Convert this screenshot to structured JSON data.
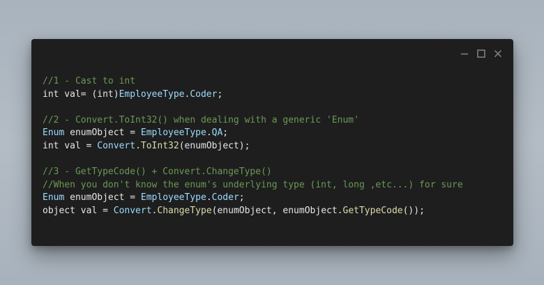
{
  "window": {
    "controls": [
      "minimize-icon",
      "maximize-icon",
      "close-icon"
    ]
  },
  "code": {
    "lines": [
      [
        {
          "t": "//1 - Cast to int",
          "k": "cm"
        }
      ],
      [
        {
          "t": "int val= (int)",
          "k": "pl"
        },
        {
          "t": "EmployeeType",
          "k": "ty"
        },
        {
          "t": ".",
          "k": "pl"
        },
        {
          "t": "Coder",
          "k": "mb"
        },
        {
          "t": ";",
          "k": "pl"
        }
      ],
      [],
      [
        {
          "t": "//2 - Convert.ToInt32() when dealing with a generic 'Enum'",
          "k": "cm"
        }
      ],
      [
        {
          "t": "Enum",
          "k": "ty"
        },
        {
          "t": " enumObject = ",
          "k": "pl"
        },
        {
          "t": "EmployeeType",
          "k": "ty"
        },
        {
          "t": ".",
          "k": "pl"
        },
        {
          "t": "QA",
          "k": "mb"
        },
        {
          "t": ";",
          "k": "pl"
        }
      ],
      [
        {
          "t": "int val = ",
          "k": "pl"
        },
        {
          "t": "Convert",
          "k": "ty"
        },
        {
          "t": ".",
          "k": "pl"
        },
        {
          "t": "ToInt32",
          "k": "fn"
        },
        {
          "t": "(enumObject);",
          "k": "pl"
        }
      ],
      [],
      [
        {
          "t": "//3 - GetTypeCode() + Convert.ChangeType()",
          "k": "cm"
        }
      ],
      [
        {
          "t": "//When you don't know the enum's underlying type (int, long ,etc...) for sure",
          "k": "cm"
        }
      ],
      [
        {
          "t": "Enum",
          "k": "ty"
        },
        {
          "t": " enumObject = ",
          "k": "pl"
        },
        {
          "t": "EmployeeType",
          "k": "ty"
        },
        {
          "t": ".",
          "k": "pl"
        },
        {
          "t": "Coder",
          "k": "mb"
        },
        {
          "t": ";",
          "k": "pl"
        }
      ],
      [
        {
          "t": "object val = ",
          "k": "pl"
        },
        {
          "t": "Convert",
          "k": "ty"
        },
        {
          "t": ".",
          "k": "pl"
        },
        {
          "t": "ChangeType",
          "k": "fn"
        },
        {
          "t": "(enumObject, enumObject.",
          "k": "pl"
        },
        {
          "t": "GetTypeCode",
          "k": "fn"
        },
        {
          "t": "());",
          "k": "pl"
        }
      ]
    ]
  },
  "colors": {
    "comment": "#6a9955",
    "plain": "#e6e6e6",
    "type": "#9cdcfe",
    "function": "#dcdcaa",
    "window_bg": "#1e1e1e"
  }
}
